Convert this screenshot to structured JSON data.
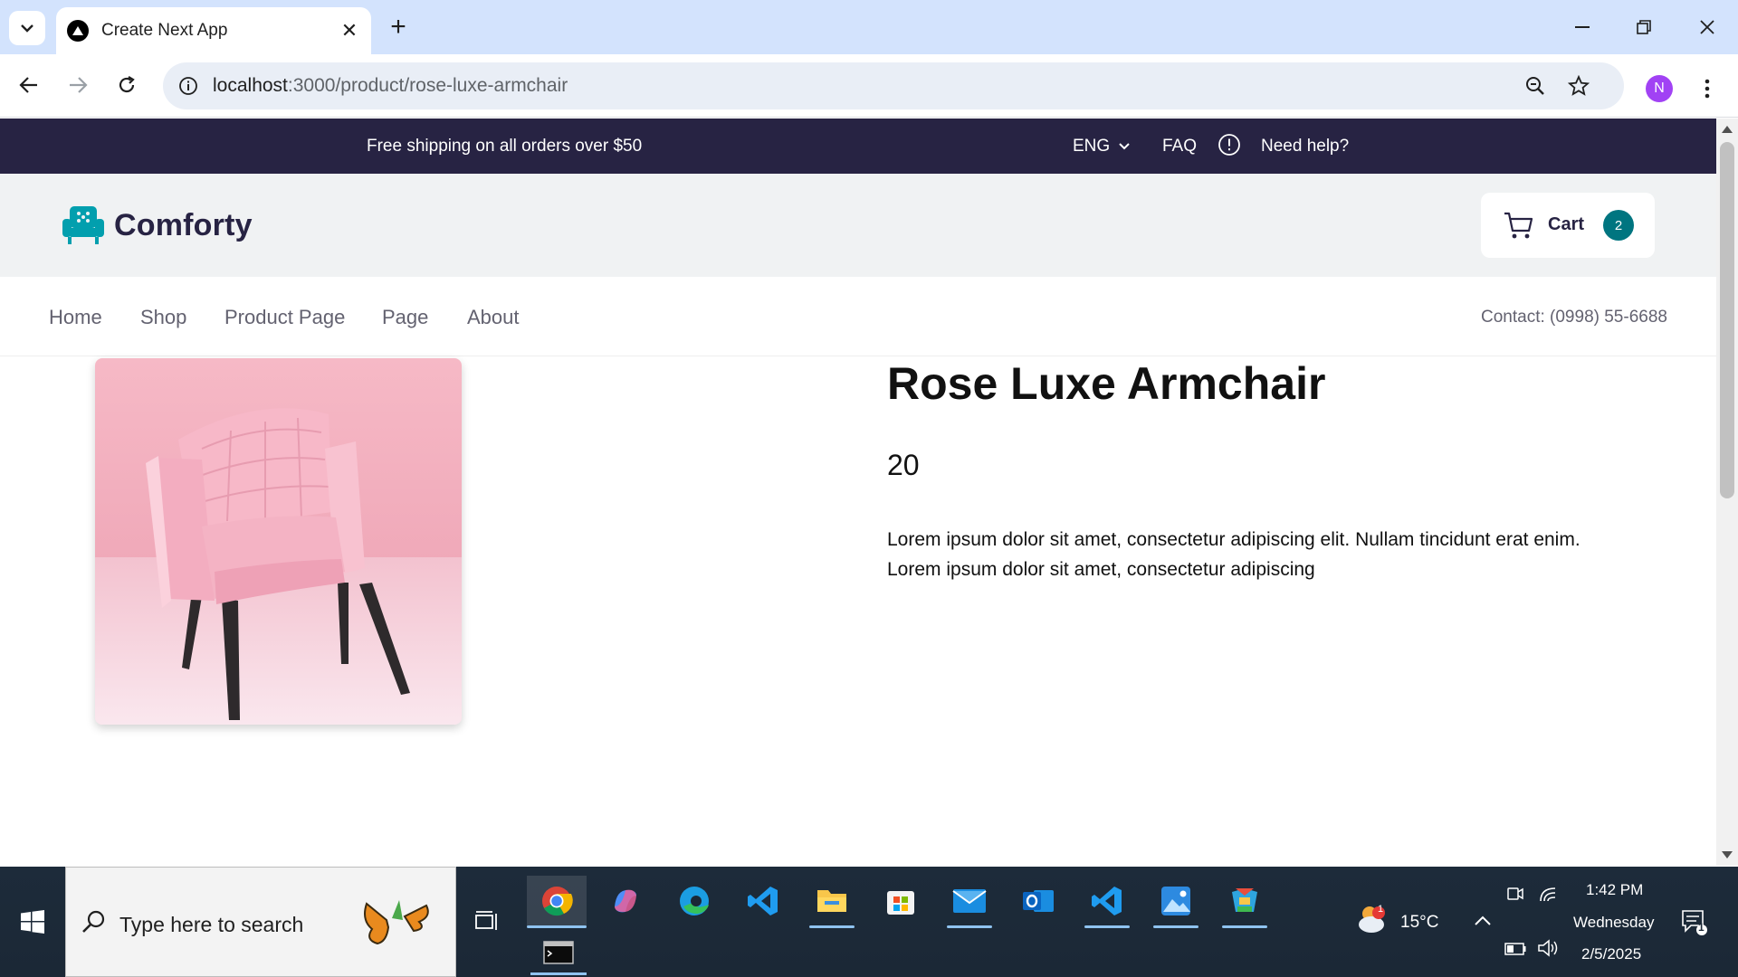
{
  "browser": {
    "tab_title": "Create Next App",
    "url_host": "localhost",
    "url_path": ":3000/product/rose-luxe-armchair",
    "profile_initial": "N"
  },
  "topbar": {
    "shipping": "Free shipping on all orders over $50",
    "language": "ENG",
    "faq": "FAQ",
    "help": "Need help?"
  },
  "header": {
    "brand": "Comforty",
    "cart_label": "Cart",
    "cart_count": "2"
  },
  "nav": {
    "links": [
      "Home",
      "Shop",
      "Product Page",
      "Page",
      "About"
    ],
    "contact": "Contact: (0998) 55-6688"
  },
  "product": {
    "title": "Rose Luxe Armchair",
    "price": "20",
    "description": "Lorem ipsum dolor sit amet, consectetur adipiscing elit. Nullam tincidunt erat enim. Lorem ipsum dolor sit amet, consectetur adipiscing"
  },
  "taskbar": {
    "search_placeholder": "Type here to search",
    "weather": "15°C",
    "weather_badge": "1",
    "time": "1:42 PM",
    "day": "Wednesday",
    "date": "2/5/2025",
    "notification_count": "1"
  },
  "colors": {
    "topbar_bg": "#272343",
    "header_bg": "#f0f2f3",
    "accent": "#007580",
    "chair_pink": "#f2b8c6"
  }
}
